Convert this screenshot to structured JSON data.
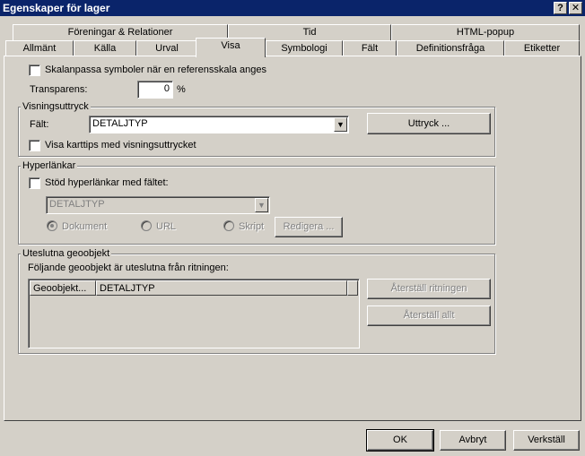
{
  "window": {
    "title": "Egenskaper för lager",
    "help_label": "?",
    "close_label": "✕"
  },
  "tabs_row1": [
    {
      "label": "Föreningar & Relationer"
    },
    {
      "label": "Tid"
    },
    {
      "label": "HTML-popup"
    }
  ],
  "tabs_row2": [
    {
      "label": "Allmänt"
    },
    {
      "label": "Källa"
    },
    {
      "label": "Urval"
    },
    {
      "label": "Visa",
      "active": true
    },
    {
      "label": "Symbologi"
    },
    {
      "label": "Fält"
    },
    {
      "label": "Definitionsfråga"
    },
    {
      "label": "Etiketter"
    }
  ],
  "options": {
    "scale_symbols_label": "Skalanpassa symboler när en referensskala anges",
    "transparency_label": "Transparens:",
    "transparency_value": "0",
    "transparency_unit": "%"
  },
  "display_expression": {
    "legend": "Visningsuttryck",
    "field_label": "Fält:",
    "field_value": "DETALJTYP",
    "expression_button": "Uttryck ...",
    "maptips_label": "Visa karttips med visningsuttrycket"
  },
  "hyperlinks": {
    "legend": "Hyperlänkar",
    "support_label": "Stöd hyperlänkar med fältet:",
    "field_value": "DETALJTYP",
    "radio_document": "Dokument",
    "radio_url": "URL",
    "radio_script": "Skript",
    "edit_button": "Redigera ..."
  },
  "excluded": {
    "legend": "Uteslutna geoobjekt",
    "description": "Följande geoobjekt är uteslutna från ritningen:",
    "columns": [
      "Geoobjekt...",
      "DETALJTYP"
    ],
    "restore_drawing_button": "Återställ ritningen",
    "restore_all_button": "Återställ allt"
  },
  "footer": {
    "ok": "OK",
    "cancel": "Avbryt",
    "apply": "Verkställ"
  }
}
